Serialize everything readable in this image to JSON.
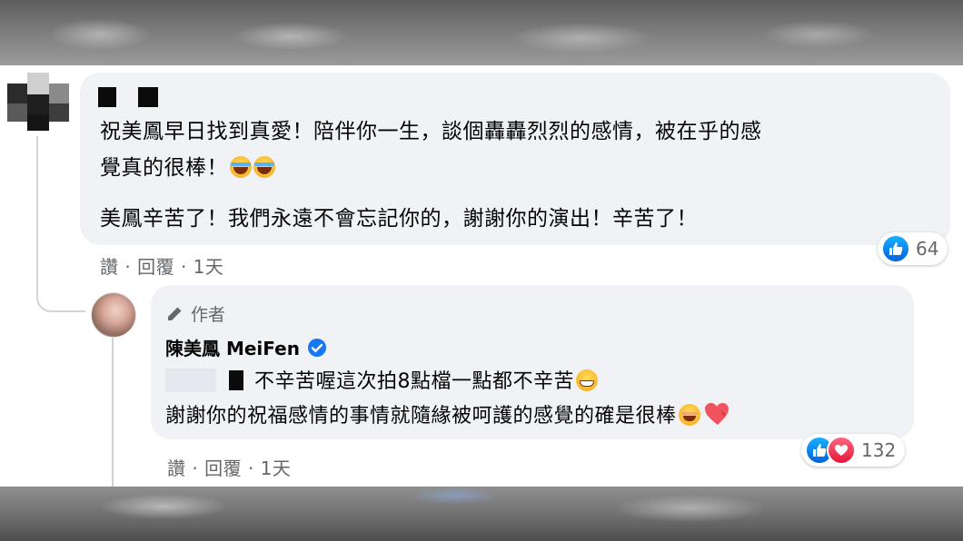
{
  "comment": {
    "lines": [
      "祝美鳳早日找到真愛！陪伴你一生，談個轟轟烈烈的感情，被在乎的感",
      "覺真的很棒！",
      "美鳳辛苦了！我們永遠不會忘記你的，謝謝你的演出！辛苦了！"
    ],
    "actions": {
      "like": "讚",
      "reply": "回覆",
      "time": "1天",
      "sep": "·"
    },
    "reactions": {
      "count": "64",
      "types": [
        "like-icon"
      ]
    }
  },
  "reply": {
    "author_badge": "作者",
    "author_name": "陳美鳳 MeiFen",
    "lines": [
      "不辛苦喔這次拍8點檔一點都不辛苦",
      "謝謝你的祝福感情的事情就隨緣被呵護的感覺的確是很棒"
    ],
    "actions": {
      "like": "讚",
      "reply": "回覆",
      "time": "1天",
      "sep": "·"
    },
    "reactions": {
      "count": "132",
      "types": [
        "like-icon",
        "love-icon"
      ]
    }
  },
  "colors": {
    "bubble": "#f0f2f5",
    "secondary_text": "#65676b",
    "like_blue": "#1877f2",
    "love_red": "#f33e58",
    "verified_blue": "#1877f2"
  }
}
